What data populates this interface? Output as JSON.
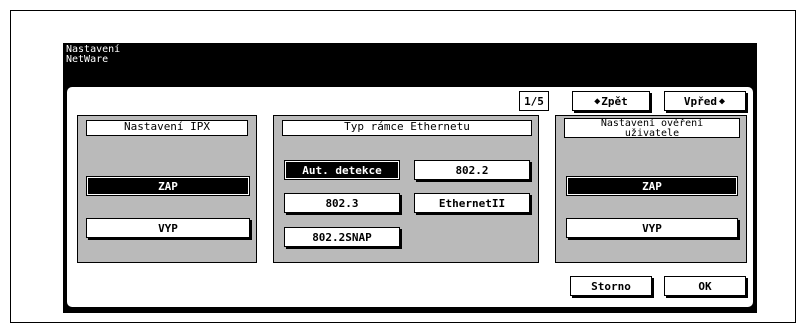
{
  "title": {
    "line1": "Nastavení",
    "line2": "NetWare"
  },
  "pager": {
    "counter": "1/5",
    "back_label": "Zpět",
    "next_label": "Vpřed",
    "back_icon": "arrow-left-icon",
    "next_icon": "arrow-right-icon"
  },
  "ipx": {
    "heading": "Nastavení IPX",
    "on_label": "ZAP",
    "off_label": "VYP",
    "selected": "ZAP"
  },
  "frame_type": {
    "heading": "Typ rámce Ethernetu",
    "options": [
      "Aut. detekce",
      "802.2",
      "802.3",
      "EthernetII",
      "802.2SNAP"
    ],
    "selected": "Aut. detekce"
  },
  "auth": {
    "heading_line1": "Nastavení ověření",
    "heading_line2": "uživatele",
    "on_label": "ZAP",
    "off_label": "VYP",
    "selected": "ZAP"
  },
  "footer": {
    "cancel_label": "Storno",
    "ok_label": "OK"
  }
}
